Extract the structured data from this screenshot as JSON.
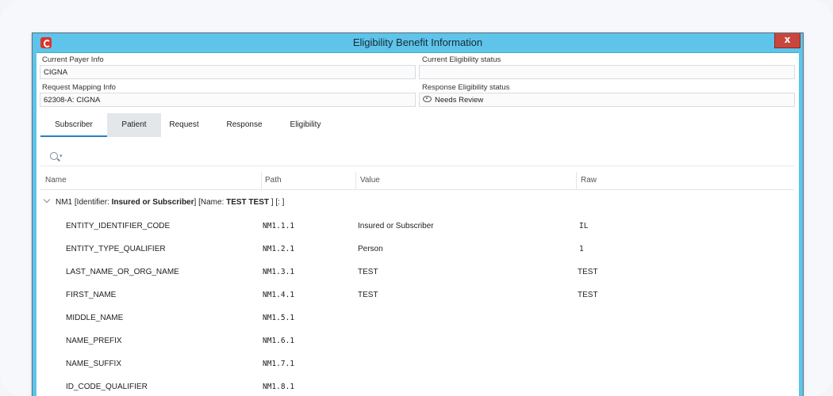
{
  "window": {
    "title": "Eligibility Benefit Information",
    "close_glyph": "x"
  },
  "fields": {
    "current_payer_label": "Current Payer Info",
    "current_payer_value": "CIGNA",
    "current_status_label": "Current Eligibility status",
    "current_status_value": "",
    "request_mapping_label": "Request Mapping Info",
    "request_mapping_value": "62308-A: CIGNA",
    "response_status_label": "Response Eligibility status",
    "response_status_value": "Needs Review"
  },
  "tabs": [
    {
      "label": "Subscriber",
      "active": true
    },
    {
      "label": "Patient",
      "active": false
    },
    {
      "label": "Request",
      "active": false
    },
    {
      "label": "Response",
      "active": false
    },
    {
      "label": "Eligibility",
      "active": false
    }
  ],
  "search": {
    "icon": "search-icon",
    "dropdown_glyph": "▾"
  },
  "columns": [
    "Name",
    "Path",
    "Value",
    "Raw"
  ],
  "group": {
    "prefix": "NM1 [Identifier: ",
    "identifier": "Insured or Subscriber",
    "middle": "] [Name: ",
    "name": "TEST TEST",
    "suffix": " ] [: ]"
  },
  "rows": [
    {
      "name": "ENTITY_IDENTIFIER_CODE",
      "path": "NM1.1.1",
      "value": "Insured or Subscriber",
      "raw": "IL"
    },
    {
      "name": "ENTITY_TYPE_QUALIFIER",
      "path": "NM1.2.1",
      "value": "Person",
      "raw": "1"
    },
    {
      "name": "LAST_NAME_OR_ORG_NAME",
      "path": "NM1.3.1",
      "value": "TEST",
      "raw": "TEST"
    },
    {
      "name": "FIRST_NAME",
      "path": "NM1.4.1",
      "value": "TEST",
      "raw": "TEST"
    },
    {
      "name": "MIDDLE_NAME",
      "path": "NM1.5.1",
      "value": "",
      "raw": ""
    },
    {
      "name": "NAME_PREFIX",
      "path": "NM1.6.1",
      "value": "",
      "raw": ""
    },
    {
      "name": "NAME_SUFFIX",
      "path": "NM1.7.1",
      "value": "",
      "raw": ""
    },
    {
      "name": "ID_CODE_QUALIFIER",
      "path": "NM1.8.1",
      "value": "",
      "raw": ""
    }
  ]
}
